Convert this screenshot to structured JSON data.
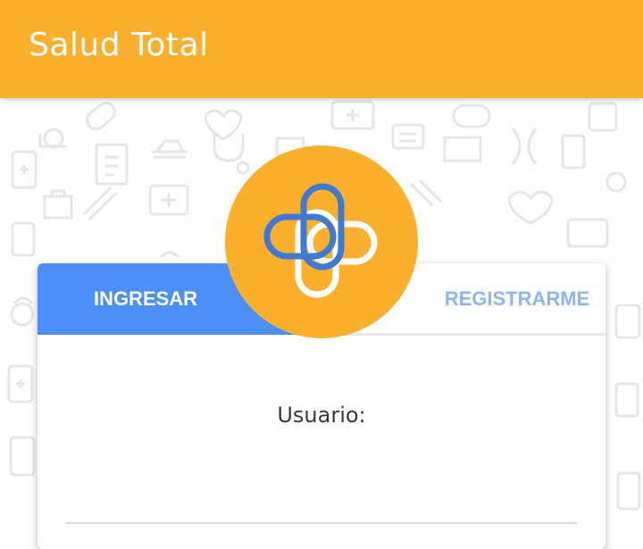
{
  "app_bar": {
    "title": "Salud Total"
  },
  "tabs": [
    {
      "label": "INGRESAR",
      "active": true
    },
    {
      "label": "REGISTRARME",
      "active": false
    }
  ],
  "form": {
    "username_label": "Usuario:"
  },
  "logo": {
    "icon": "medical-cross-logo-icon"
  },
  "colors": {
    "primary": "#fbb02d",
    "accent": "#4d8ff8",
    "inactive_tab_text": "#8db5f3",
    "logo_blue": "#3f79d1",
    "logo_white": "#ffffff"
  }
}
